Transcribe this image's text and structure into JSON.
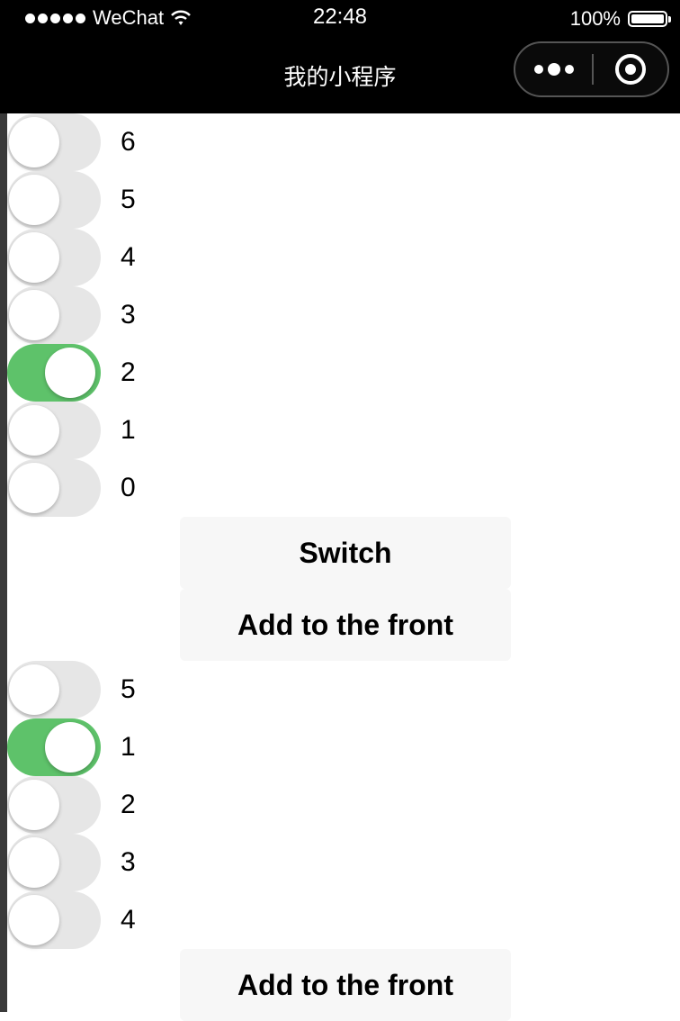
{
  "status_bar": {
    "dots_count": 5,
    "carrier": "WeChat",
    "time": "22:48",
    "battery": "100%"
  },
  "nav": {
    "title": "我的小程序",
    "more_icon": "more-dots-icon",
    "close_icon": "target-ring-icon"
  },
  "colors": {
    "switch_on": "#5ec26a",
    "switch_off": "#e6e6e6",
    "button_bg": "#f7f7f7",
    "bar_bg": "#000000"
  },
  "list1": [
    {
      "label": "6",
      "checked": false
    },
    {
      "label": "5",
      "checked": false
    },
    {
      "label": "4",
      "checked": false
    },
    {
      "label": "3",
      "checked": false
    },
    {
      "label": "2",
      "checked": true
    },
    {
      "label": "1",
      "checked": false
    },
    {
      "label": "0",
      "checked": false
    }
  ],
  "buttons": {
    "switch": "Switch",
    "add_front_1": "Add to the front",
    "add_front_2": "Add to the front"
  },
  "list2": [
    {
      "label": "5",
      "checked": false
    },
    {
      "label": "1",
      "checked": true
    },
    {
      "label": "2",
      "checked": false
    },
    {
      "label": "3",
      "checked": false
    },
    {
      "label": "4",
      "checked": false
    }
  ]
}
